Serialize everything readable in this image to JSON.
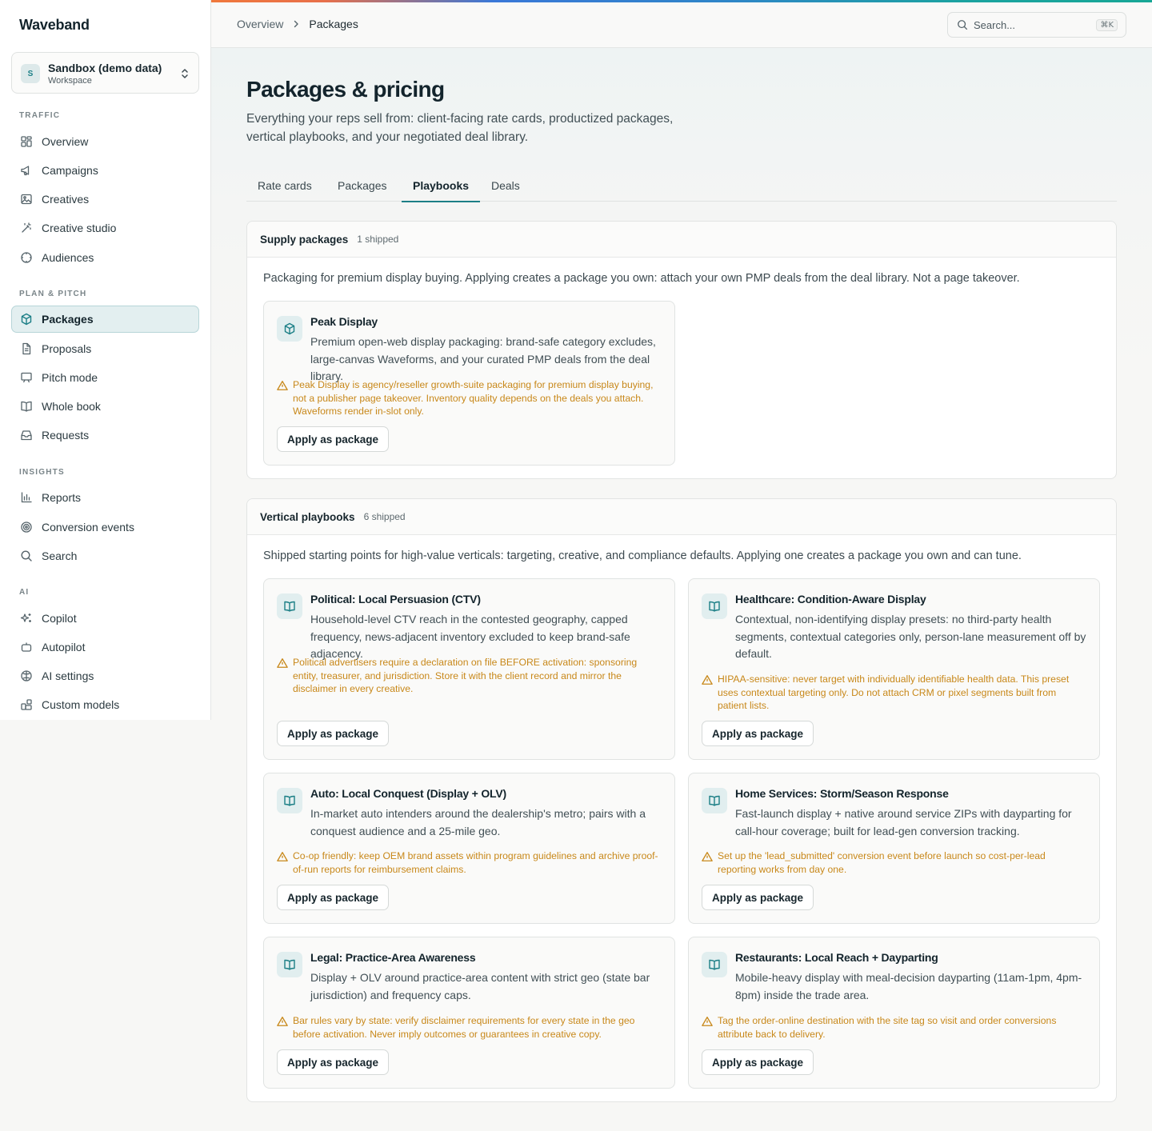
{
  "app": {
    "brand": "Waveband"
  },
  "workspace": {
    "avatar": "S",
    "name": "Sandbox (demo data)",
    "sub": "Workspace"
  },
  "nav": {
    "sections": [
      {
        "label": "TRAFFIC",
        "items": [
          "Overview",
          "Campaigns",
          "Creatives",
          "Creative studio",
          "Audiences"
        ]
      },
      {
        "label": "PLAN & PITCH",
        "items": [
          "Packages",
          "Proposals",
          "Pitch mode",
          "Whole book",
          "Requests"
        ]
      },
      {
        "label": "INSIGHTS",
        "items": [
          "Reports",
          "Conversion events",
          "Search"
        ]
      },
      {
        "label": "AI",
        "items": [
          "Copilot",
          "Autopilot",
          "AI settings",
          "Custom models"
        ]
      }
    ],
    "active": "Packages"
  },
  "header": {
    "breadcrumb": [
      "Overview",
      "Packages"
    ],
    "search_placeholder": "Search...",
    "search_shortcut": "⌘K"
  },
  "page": {
    "title": "Packages & pricing",
    "description": "Everything your reps sell from: client-facing rate cards, productized packages, vertical playbooks, and your negotiated deal library.",
    "tabs": [
      "Rate cards",
      "Packages",
      "Playbooks",
      "Deals"
    ],
    "active_tab": "Playbooks"
  },
  "supply": {
    "title": "Supply packages",
    "count": "1 shipped",
    "description": "Packaging for premium display buying. Applying creates a package you own: attach your own PMP deals from the deal library. Not a page takeover.",
    "cards": [
      {
        "title": "Peak Display",
        "body": "Premium open-web display packaging: brand-safe category excludes, large-canvas Waveforms, and your curated PMP deals from the deal library.",
        "warning": "Peak Display is agency/reseller growth-suite packaging for premium display buying, not a publisher page takeover. Inventory quality depends on the deals you attach. Waveforms render in-slot only.",
        "button": "Apply as package",
        "icon": "cube-icon"
      }
    ]
  },
  "vertical": {
    "title": "Vertical playbooks",
    "count": "6 shipped",
    "description": "Shipped starting points for high-value verticals: targeting, creative, and compliance defaults. Applying one creates a package you own and can tune.",
    "cards": [
      {
        "title": "Political: Local Persuasion (CTV)",
        "body": "Household-level CTV reach in the contested geography, capped frequency, news-adjacent inventory excluded to keep brand-safe adjacency.",
        "warning": "Political advertisers require a declaration on file BEFORE activation: sponsoring entity, treasurer, and jurisdiction. Store it with the client record and mirror the disclaimer in every creative.",
        "button": "Apply as package",
        "icon": "book-icon"
      },
      {
        "title": "Healthcare: Condition-Aware Display",
        "body": "Contextual, non-identifying display presets: no third-party health segments, contextual categories only, person-lane measurement off by default.",
        "warning": "HIPAA-sensitive: never target with individually identifiable health data. This preset uses contextual targeting only. Do not attach CRM or pixel segments built from patient lists.",
        "button": "Apply as package",
        "icon": "book-icon"
      },
      {
        "title": "Auto: Local Conquest (Display + OLV)",
        "body": "In-market auto intenders around the dealership's metro; pairs with a conquest audience and a 25-mile geo.",
        "warning": "Co-op friendly: keep OEM brand assets within program guidelines and archive proof-of-run reports for reimbursement claims.",
        "button": "Apply as package",
        "icon": "book-icon"
      },
      {
        "title": "Home Services: Storm/Season Response",
        "body": "Fast-launch display + native around service ZIPs with dayparting for call-hour coverage; built for lead-gen conversion tracking.",
        "warning": "Set up the 'lead_submitted' conversion event before launch so cost-per-lead reporting works from day one.",
        "button": "Apply as package",
        "icon": "book-icon"
      },
      {
        "title": "Legal: Practice-Area Awareness",
        "body": "Display + OLV around practice-area content with strict geo (state bar jurisdiction) and frequency caps.",
        "warning": "Bar rules vary by state: verify disclaimer requirements for every state in the geo before activation. Never imply outcomes or guarantees in creative copy.",
        "button": "Apply as package",
        "icon": "book-icon"
      },
      {
        "title": "Restaurants: Local Reach + Dayparting",
        "body": "Mobile-heavy display with meal-decision dayparting (11am-1pm, 4pm-8pm) inside the trade area.",
        "warning": "Tag the order-online destination with the site tag so visit and order conversions attribute back to delivery.",
        "button": "Apply as package",
        "icon": "book-icon"
      }
    ]
  },
  "colors": {
    "accent": "#1c7f86",
    "warning": "#c8881a",
    "active_nav_bg": "#e3eff0"
  }
}
